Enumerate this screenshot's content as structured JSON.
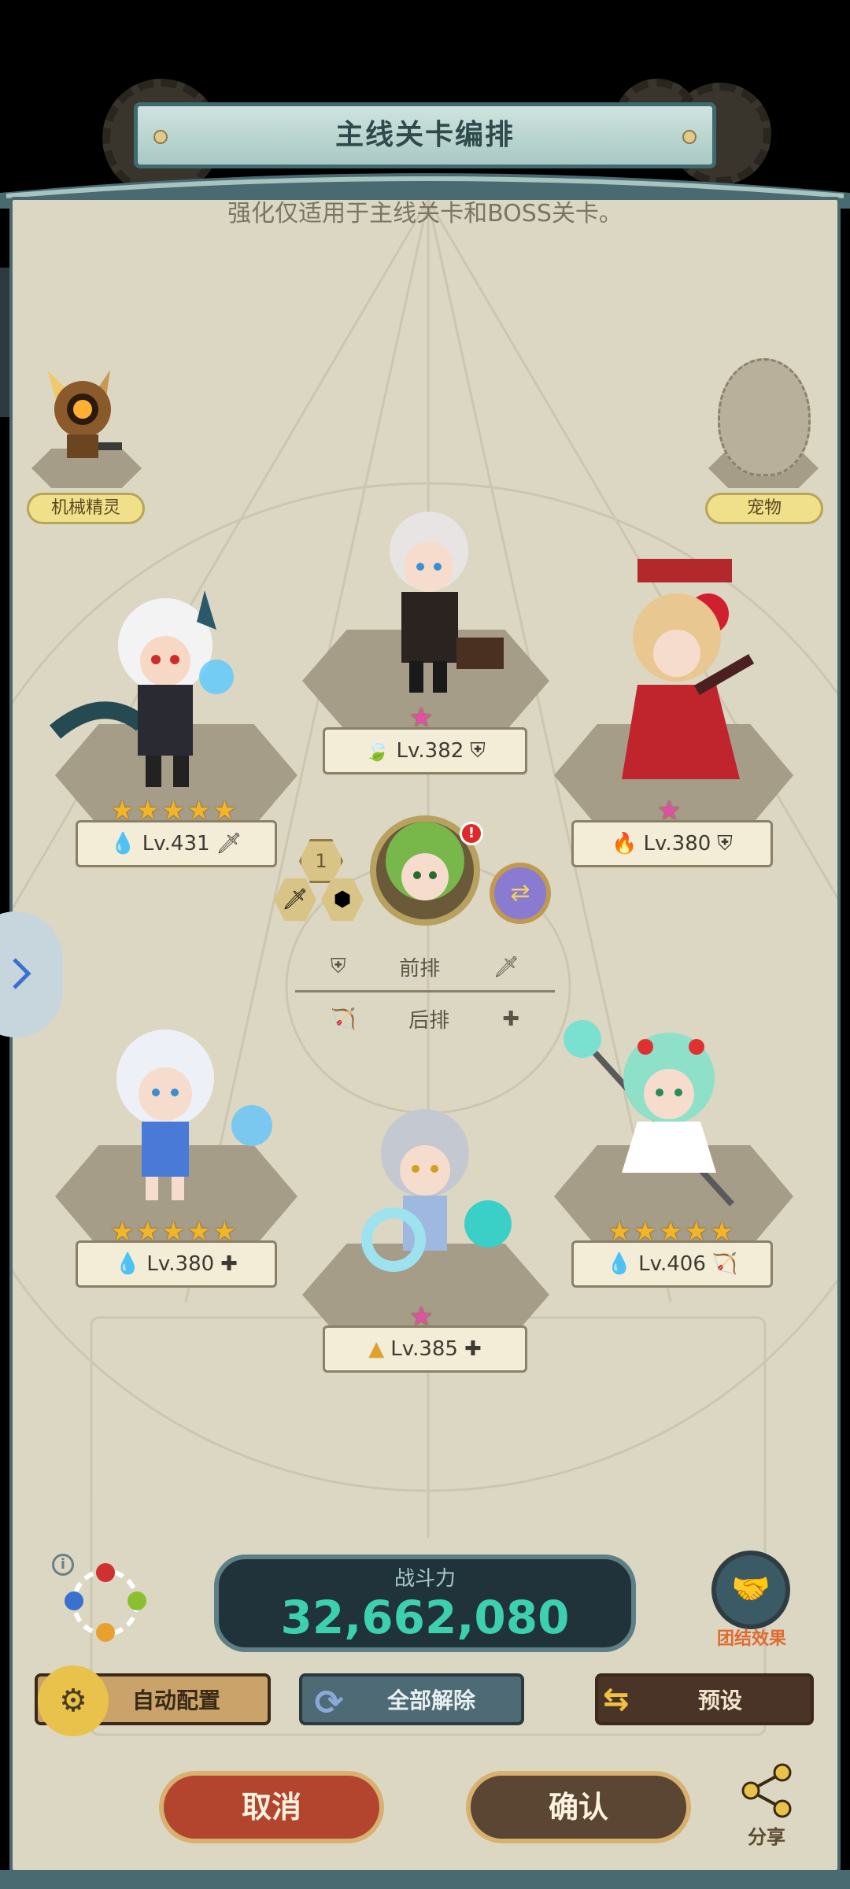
{
  "header": {
    "title": "主线关卡编排",
    "notice": "强化仅适用于主线关卡和BOSS关卡。"
  },
  "side_slots": {
    "mech_label": "机械精灵",
    "pet_label": "宠物"
  },
  "heroes": [
    {
      "id": "hero-dragon",
      "level": "Lv.431",
      "stars": 5,
      "element": "water",
      "role": "sword"
    },
    {
      "id": "hero-gentleman",
      "level": "Lv.382",
      "stars": 1,
      "element": "leaf",
      "role": "shield"
    },
    {
      "id": "hero-rose",
      "level": "Lv.380",
      "stars": 1,
      "element": "fire",
      "role": "shield"
    },
    {
      "id": "hero-ice",
      "level": "Lv.380",
      "stars": 5,
      "element": "water",
      "role": "plus"
    },
    {
      "id": "hero-bubble",
      "level": "Lv.385",
      "stars": 1,
      "element": "earth",
      "role": "plus"
    },
    {
      "id": "hero-staff",
      "level": "Lv.406",
      "stars": 5,
      "element": "water",
      "role": "bow"
    }
  ],
  "leader": {
    "badge": "1"
  },
  "formation": {
    "front": "前排",
    "back": "后排"
  },
  "power": {
    "label": "战斗力",
    "value": "32,662,080"
  },
  "team_effect": {
    "label": "团结效果"
  },
  "buttons": {
    "auto": "自动配置",
    "release": "全部解除",
    "preset": "预设",
    "cancel": "取消",
    "confirm": "确认",
    "share": "分享"
  },
  "colors": {
    "accent_teal": "#3cd0b0",
    "panel_bg": "#dcd7c2",
    "cancel_red": "#b3452f",
    "confirm_brown": "#5a4632"
  }
}
